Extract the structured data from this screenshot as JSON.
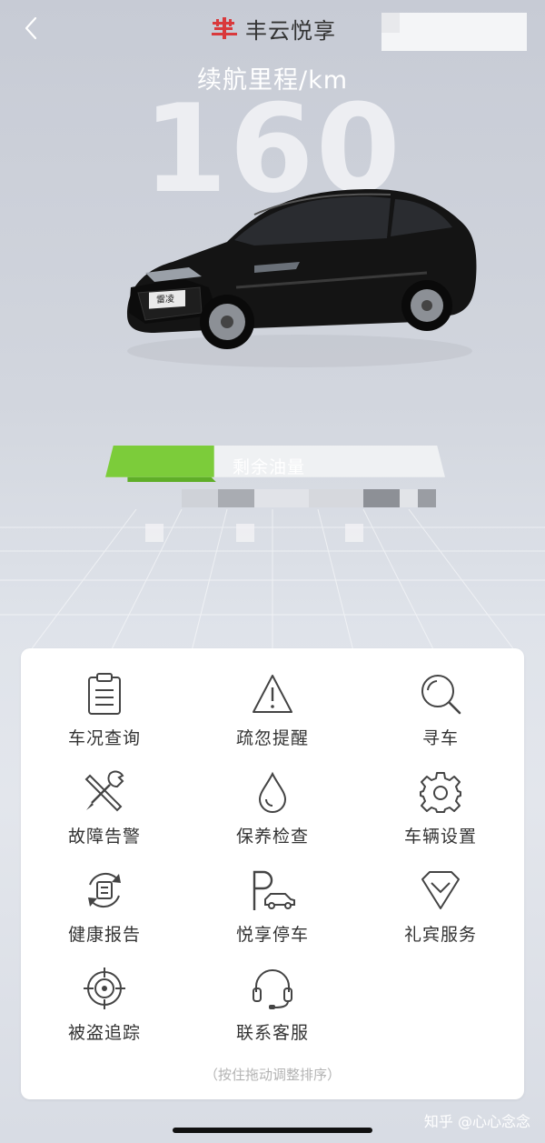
{
  "header": {
    "brand_name": "丰云悦享",
    "back_icon": "chevron-left-icon",
    "logo_icon": "fengyun-logo-icon"
  },
  "range": {
    "label": "续航里程/km",
    "value": "160"
  },
  "fuel": {
    "label": "剩余油量",
    "level_fraction": 0.32,
    "fill_color": "#7ccc3a"
  },
  "menu": {
    "items": [
      {
        "label": "车况查询",
        "icon": "clipboard-icon"
      },
      {
        "label": "疏忽提醒",
        "icon": "warning-triangle-icon"
      },
      {
        "label": "寻车",
        "icon": "magnifier-icon"
      },
      {
        "label": "故障告警",
        "icon": "wrench-screwdriver-icon"
      },
      {
        "label": "保养检查",
        "icon": "oil-drop-icon"
      },
      {
        "label": "车辆设置",
        "icon": "gear-icon"
      },
      {
        "label": "健康报告",
        "icon": "refresh-report-icon"
      },
      {
        "label": "悦享停车",
        "icon": "parking-car-icon"
      },
      {
        "label": "礼宾服务",
        "icon": "concierge-shield-icon"
      },
      {
        "label": "被盗追踪",
        "icon": "crosshair-icon"
      },
      {
        "label": "联系客服",
        "icon": "headset-icon"
      }
    ],
    "hint": "（按住拖动调整排序）"
  },
  "watermark": "知乎 @心心念念",
  "colors": {
    "accent_red": "#d9393c",
    "card_bg": "#ffffff",
    "icon_stroke": "#444444"
  }
}
